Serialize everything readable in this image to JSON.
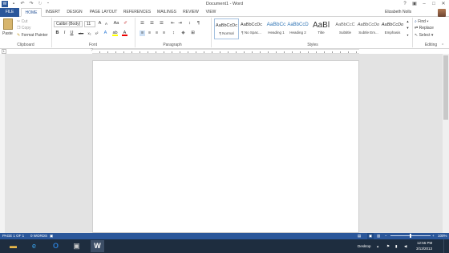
{
  "window": {
    "title": "Document1 - Word",
    "controls": [
      "?",
      "▣",
      "–",
      "□",
      "✕"
    ]
  },
  "tabs": [
    "FILE",
    "HOME",
    "INSERT",
    "DESIGN",
    "PAGE LAYOUT",
    "REFERENCES",
    "MAILINGS",
    "REVIEW",
    "VIEW"
  ],
  "user": {
    "name": "Elizabeth Nolls"
  },
  "clipboard": {
    "paste": "Paste",
    "cut": "Cut",
    "copy": "Copy",
    "format_painter": "Format Painter",
    "group_label": "Clipboard"
  },
  "font": {
    "name": "Calibri (Body)",
    "size": "11",
    "group_label": "Font",
    "buttons": [
      "B",
      "I",
      "U",
      "abc",
      "x₂",
      "x²"
    ]
  },
  "paragraph": {
    "group_label": "Paragraph"
  },
  "styles": {
    "group_label": "Styles",
    "items": [
      {
        "sample": "AaBbCcDc",
        "name": "¶ Normal"
      },
      {
        "sample": "AaBbCcDc",
        "name": "¶ No Spac..."
      },
      {
        "sample": "AaBbCc",
        "name": "Heading 1"
      },
      {
        "sample": "AaBbCcD",
        "name": "Heading 2"
      },
      {
        "sample": "AaBl",
        "name": "Title"
      },
      {
        "sample": "AaBbCcC",
        "name": "Subtitle"
      },
      {
        "sample": "AaBbCcDo",
        "name": "Subtle Em..."
      },
      {
        "sample": "AaBbCcDo",
        "name": "Emphasis"
      }
    ]
  },
  "editing": {
    "find": "Find",
    "replace": "Replace",
    "select": "Select",
    "group_label": "Editing"
  },
  "status": {
    "page": "PAGE 1 OF 1",
    "words": "0 WORDS",
    "zoom": "100%"
  },
  "taskbar": {
    "desktop_label": "Desktop",
    "time": "12:56 PM",
    "date": "3/13/2013"
  },
  "colors": {
    "accent": "#2b579a",
    "taskbar": "#1e2d3f"
  }
}
